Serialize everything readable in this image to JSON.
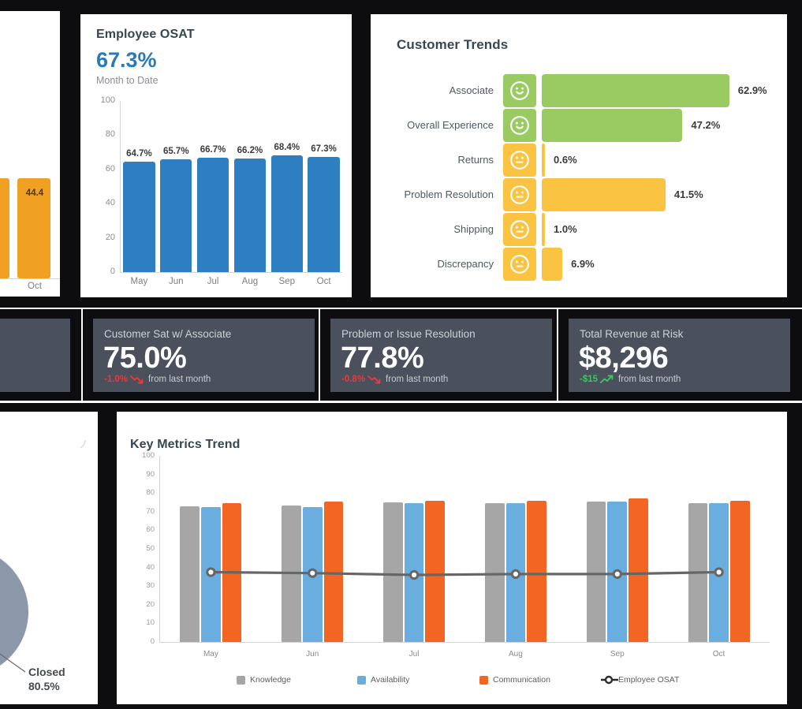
{
  "theme": {
    "background": "#0d0d0f",
    "panel_bg": "#ffffff",
    "kpi_bg": "#4a505c",
    "blue": "#2e7fc1",
    "green": "#9acb63",
    "amber": "#fbc342",
    "orange": "#f26522",
    "gray": "#a6a6a6",
    "light_blue": "#6aaee0",
    "line_gray": "#666666",
    "donut_gray": "#8b98a9",
    "up": "#3fc55f",
    "down": "#e8393b"
  },
  "left_bar_fragment": {
    "name": "partial-bar-chart",
    "value_label": "44.4",
    "x_tick": "Oct"
  },
  "employee_osat": {
    "title": "Employee OSAT",
    "headline": "67.3%",
    "subtitle": "Month to Date"
  },
  "customer_trends": {
    "title": "Customer Trends"
  },
  "kpis": [
    {
      "title": "Customer Sat w/ Associate",
      "value": "75.0%",
      "delta": "-1.0%",
      "direction": "down",
      "note": "from last month"
    },
    {
      "title": "Problem or Issue Resolution",
      "value": "77.8%",
      "delta": "-0.8%",
      "direction": "down",
      "note": "from last month"
    },
    {
      "title": "Total Revenue at Risk",
      "value": "$8,296",
      "delta": "-$15",
      "direction": "up",
      "note": "from last month"
    }
  ],
  "key_metrics": {
    "title": "Key Metrics Trend"
  },
  "donut_fragment": {
    "label": "Closed",
    "value": "80.5%"
  },
  "chart_data": [
    {
      "id": "employee-osat-chart",
      "type": "bar",
      "title": "Employee OSAT",
      "headline_value": 67.3,
      "headline_text": "67.3%",
      "subtitle": "Month to Date",
      "categories": [
        "May",
        "Jun",
        "Jul",
        "Aug",
        "Sep",
        "Oct"
      ],
      "values": [
        64.7,
        65.7,
        66.7,
        66.2,
        68.4,
        67.3
      ],
      "data_labels": [
        "64.7%",
        "65.7%",
        "66.7%",
        "66.2%",
        "68.4%",
        "67.3%"
      ],
      "ylim": [
        0,
        100
      ],
      "yticks": [
        0,
        20,
        40,
        60,
        80,
        100
      ],
      "ytick_labels": [
        "0",
        "20",
        "40",
        "60",
        "80",
        "100"
      ],
      "xlabel": "",
      "ylabel": "",
      "grid": false,
      "series_color": "#2e7fc1",
      "legend": "none"
    },
    {
      "id": "customer-trends-chart",
      "type": "bar",
      "orientation": "horizontal",
      "title": "Customer Trends",
      "categories": [
        "Associate",
        "Overall Experience",
        "Returns",
        "Problem Resolution",
        "Shipping",
        "Discrepancy"
      ],
      "values": [
        62.9,
        47.2,
        0.6,
        41.5,
        1.0,
        6.9
      ],
      "data_labels": [
        "62.9%",
        "47.2%",
        "0.6%",
        "41.5%",
        "1.0%",
        "6.9%"
      ],
      "bar_colors": [
        "#9acb63",
        "#9acb63",
        "#fbc342",
        "#fbc342",
        "#fbc342",
        "#fbc342"
      ],
      "icons": [
        "smiley-happy-icon",
        "smiley-happy-icon",
        "smiley-neutral-icon",
        "smiley-neutral-icon",
        "smiley-neutral-icon",
        "smiley-neutral-icon"
      ],
      "icon_moods": [
        "happy",
        "happy",
        "neutral",
        "neutral",
        "neutral",
        "neutral"
      ],
      "xlim": [
        0,
        70
      ],
      "grid": false,
      "legend": "none"
    },
    {
      "id": "key-metrics-trend-chart",
      "type": "bar",
      "combo": "bar+line",
      "title": "Key Metrics Trend",
      "categories": [
        "May",
        "Jun",
        "Jul",
        "Aug",
        "Sep",
        "Oct"
      ],
      "series": [
        {
          "name": "Knowledge",
          "type": "bar",
          "color": "#a6a6a6",
          "values": [
            73,
            73.5,
            75,
            74.5,
            75.5,
            74.5
          ]
        },
        {
          "name": "Availability",
          "type": "bar",
          "color": "#6aaee0",
          "values": [
            72.5,
            72.5,
            74.5,
            74.5,
            75.5,
            74.5
          ]
        },
        {
          "name": "Communication",
          "type": "bar",
          "color": "#f26522",
          "values": [
            74.5,
            75.5,
            76,
            76,
            77,
            76
          ]
        },
        {
          "name": "Employee OSAT",
          "type": "line",
          "color": "#666666",
          "values": [
            37.5,
            37,
            36,
            36.5,
            36.5,
            37.5
          ]
        }
      ],
      "ylim": [
        0,
        100
      ],
      "yticks": [
        0,
        10,
        20,
        30,
        40,
        50,
        60,
        70,
        80,
        90,
        100
      ],
      "ytick_labels": [
        "0",
        "10",
        "20",
        "30",
        "40",
        "50",
        "60",
        "70",
        "80",
        "90",
        "100"
      ],
      "xlabel": "",
      "ylabel": "",
      "grid": false,
      "legend": "bottom",
      "legend_entries": [
        "Knowledge",
        "Availability",
        "Communication",
        "Employee OSAT"
      ]
    },
    {
      "id": "case-status-donut-fragment",
      "type": "pie",
      "donut": true,
      "labels": [
        "Closed"
      ],
      "values": [
        80.5
      ],
      "data_labels": [
        "80.5%"
      ],
      "colors": [
        "#8b98a9"
      ],
      "legend": "none",
      "note": "partially cropped at left edge"
    },
    {
      "id": "left-orange-bar-fragment",
      "type": "bar",
      "categories": [
        "Oct"
      ],
      "values": [
        44.4
      ],
      "data_labels": [
        "44.4"
      ],
      "colors": [
        "#f0a022"
      ],
      "legend": "none",
      "note": "partially cropped at left edge"
    }
  ]
}
